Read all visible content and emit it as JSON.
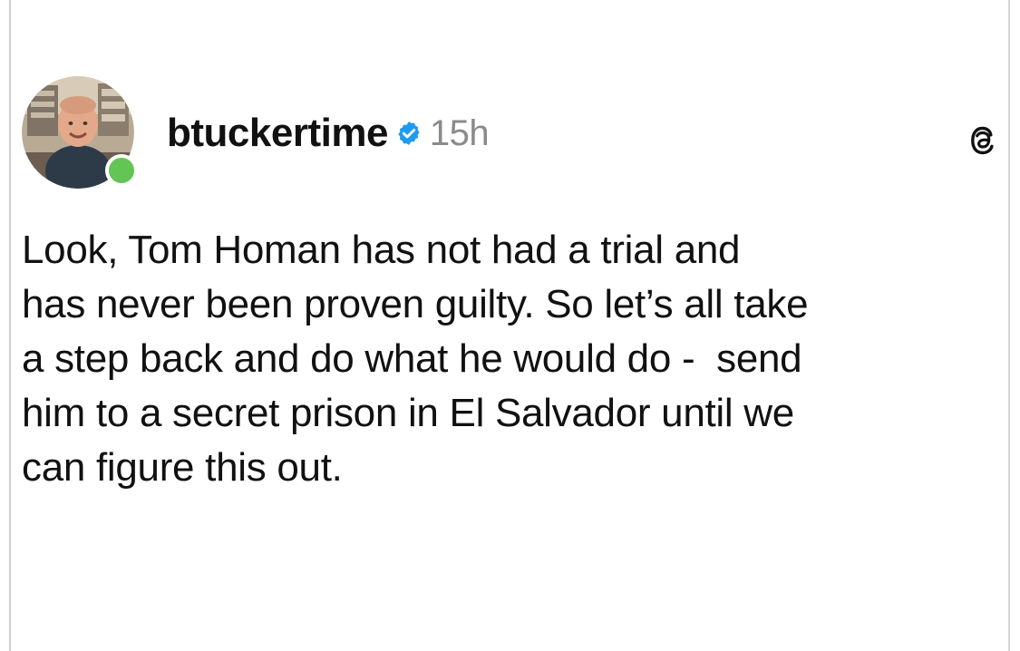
{
  "post": {
    "username": "btuckertime",
    "timestamp": "15h",
    "verified_icon": "verified-badge-icon",
    "platform_icon": "threads-logo-icon",
    "online_status_color": "#62c554",
    "verified_color": "#1d9bf0",
    "text_lines": [
      "Look, Tom Homan has not had a trial and",
      "has never been proven guilty. So let’s all take",
      "a step back and do what he would do -  send",
      "him to a secret prison in El Salvador until we",
      "can figure this out."
    ]
  }
}
